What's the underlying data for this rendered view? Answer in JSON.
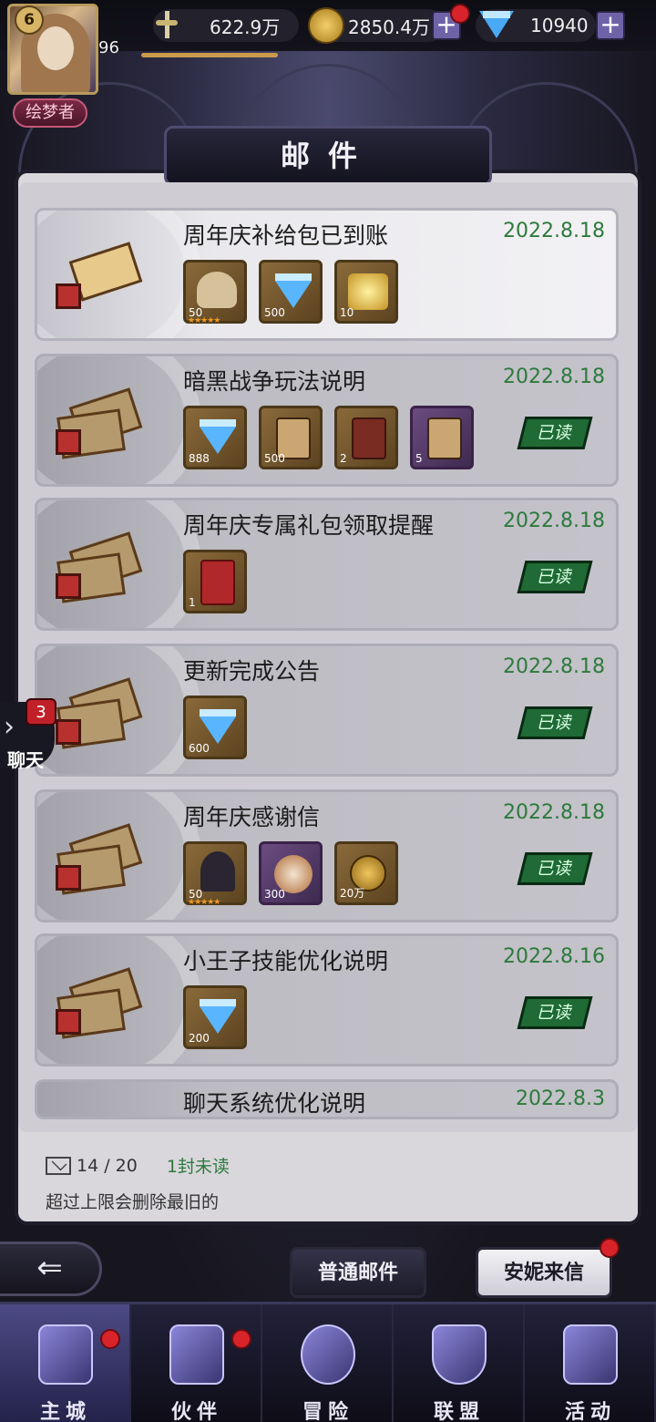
{
  "status": {
    "level": "6",
    "power_sub": "96",
    "power": "622.9万",
    "gold": "2850.4万",
    "gems": "10940",
    "title_badge": "绘梦者"
  },
  "page": {
    "title": "邮件"
  },
  "mails": [
    {
      "title": "周年庆补给包已到账",
      "date": "2022.8.18",
      "read": false,
      "items": [
        {
          "icon": "skull-item",
          "count": "50",
          "stars": "★★★★★"
        },
        {
          "icon": "gem",
          "count": "500"
        },
        {
          "icon": "gold-chest",
          "count": "10"
        }
      ]
    },
    {
      "title": "暗黑战争玩法说明",
      "date": "2022.8.18",
      "read": true,
      "items": [
        {
          "icon": "gem",
          "count": "888"
        },
        {
          "icon": "scroll",
          "count": "500"
        },
        {
          "icon": "red-scroll",
          "count": "2"
        },
        {
          "icon": "purple-scroll",
          "count": "5"
        }
      ]
    },
    {
      "title": "周年庆专属礼包领取提醒",
      "date": "2022.8.18",
      "read": true,
      "items": [
        {
          "icon": "red-envelope",
          "count": "1"
        }
      ]
    },
    {
      "title": "更新完成公告",
      "date": "2022.8.18",
      "read": true,
      "items": [
        {
          "icon": "gem",
          "count": "600"
        }
      ]
    },
    {
      "title": "周年庆感谢信",
      "date": "2022.8.18",
      "read": true,
      "items": [
        {
          "icon": "hooded-hero",
          "count": "50",
          "stars": "★★★★★"
        },
        {
          "icon": "orb",
          "count": "300"
        },
        {
          "icon": "coin",
          "count": "20万"
        }
      ]
    },
    {
      "title": "小王子技能优化说明",
      "date": "2022.8.16",
      "read": true,
      "items": [
        {
          "icon": "gem",
          "count": "200"
        }
      ]
    },
    {
      "title": "聊天系统优化说明",
      "date": "2022.8.3",
      "read": true,
      "items": []
    }
  ],
  "read_label": "已读",
  "footer": {
    "count": "14 / 20",
    "unread": "1封未读",
    "note": "超过上限会删除最旧的"
  },
  "chat": {
    "label": "聊天",
    "badge": "3"
  },
  "buttons": {
    "normal_mail": "普通邮件",
    "annie_mail": "安妮来信"
  },
  "nav": [
    {
      "label": "主城",
      "icon": "castle-icon",
      "active": true
    },
    {
      "label": "伙伴",
      "icon": "hat-icon",
      "active": false
    },
    {
      "label": "冒险",
      "icon": "compass-icon",
      "active": false
    },
    {
      "label": "联盟",
      "icon": "shield-icon",
      "active": false
    },
    {
      "label": "活动",
      "icon": "cards-icon",
      "active": false
    }
  ]
}
